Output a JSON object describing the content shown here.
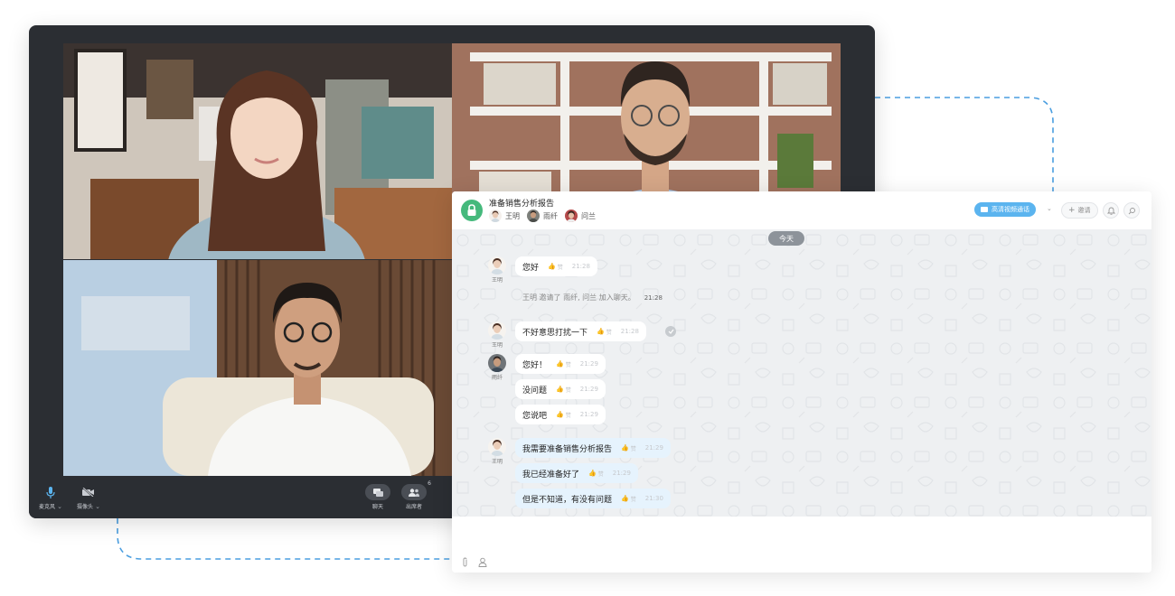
{
  "video_call": {
    "toolbar": {
      "microphone_label": "麦克风",
      "camera_label": "摄像头",
      "chat_label": "聊天",
      "participants_label": "出席者",
      "participants_count": "6"
    }
  },
  "chat": {
    "title": "准备销售分析报告",
    "members": [
      "王明",
      "雨纤",
      "问兰"
    ],
    "hd_call_label": "高清视频通话",
    "invite_label": "邀请",
    "date_chip": "今天",
    "like_label": "赞",
    "messages": [
      {
        "sender": "王明",
        "text": "您好",
        "time": "21:28"
      },
      {
        "system": "王明 邀请了 雨纤, 问兰 加入聊天。",
        "time": "21:28"
      },
      {
        "sender": "王明",
        "text": "不好意思打扰一下",
        "time": "21:28"
      },
      {
        "sender": "雨纤",
        "text": "您好！",
        "time": "21:29"
      },
      {
        "sender": "雨纤",
        "text": "没问题",
        "time": "21:29"
      },
      {
        "sender": "雨纤",
        "text": "您说吧",
        "time": "21:29"
      },
      {
        "sender": "王明",
        "text": "我需要准备销售分析报告",
        "time": "21:29"
      },
      {
        "sender": "王明",
        "text": "我已经准备好了",
        "time": "21:29"
      },
      {
        "sender": "王明",
        "text": "但是不知道，有没有问题",
        "time": "21:30"
      }
    ]
  },
  "colors": {
    "accent": "#5bb4ef",
    "lock_green": "#45b97c",
    "video_frame": "#2b2e33",
    "chat_bg": "#eef0f2",
    "own_bubble": "#e6f3fd",
    "connector": "#4a9ee0"
  },
  "icons": [
    "microphone-icon",
    "camera-off-icon",
    "chat-icon",
    "participants-icon",
    "lock-icon",
    "video-camera-icon",
    "plus-icon",
    "bell-icon",
    "search-icon",
    "attachment-icon",
    "contact-icon",
    "check-icon"
  ]
}
